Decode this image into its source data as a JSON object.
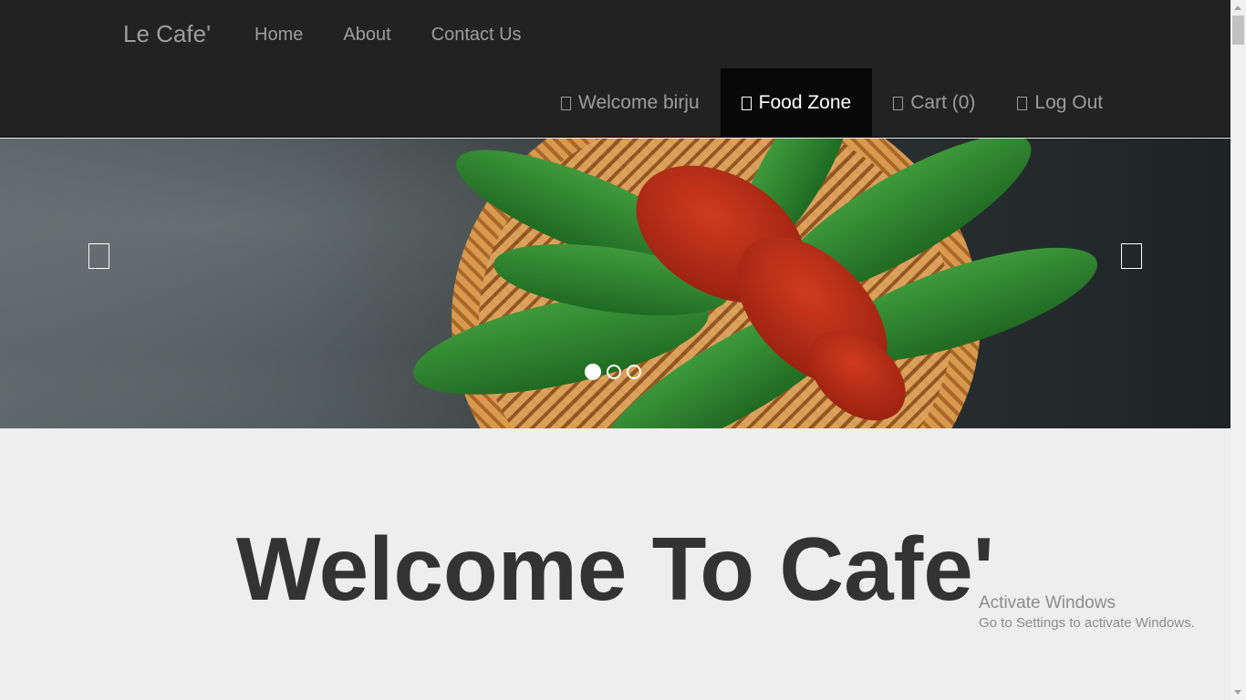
{
  "navbar": {
    "brand": "Le Cafe'",
    "top_links": [
      {
        "label": "Home"
      },
      {
        "label": "About"
      },
      {
        "label": "Contact Us"
      }
    ],
    "right_links": [
      {
        "label": "Welcome birju",
        "icon": "user-icon"
      },
      {
        "label": "Food Zone",
        "icon": "cutlery-icon",
        "active": true
      },
      {
        "label": "Cart (0)",
        "icon": "shopping-cart-icon"
      },
      {
        "label": "Log Out",
        "icon": "log-out-icon"
      }
    ]
  },
  "carousel": {
    "image": "lobster-on-bamboo-leaves",
    "prev_icon": "chevron-left-icon",
    "next_icon": "chevron-right-icon",
    "indicators": 3,
    "active_index": 0
  },
  "main": {
    "headline": "Welcome To Cafe'"
  },
  "watermark": {
    "line1": "Activate Windows",
    "line2": "Go to Settings to activate Windows."
  },
  "colors": {
    "navbar_bg": "#222222",
    "nav_text": "#9d9d9d",
    "active_bg": "#080808",
    "page_bg": "#eeeeee",
    "headline": "#333333"
  }
}
